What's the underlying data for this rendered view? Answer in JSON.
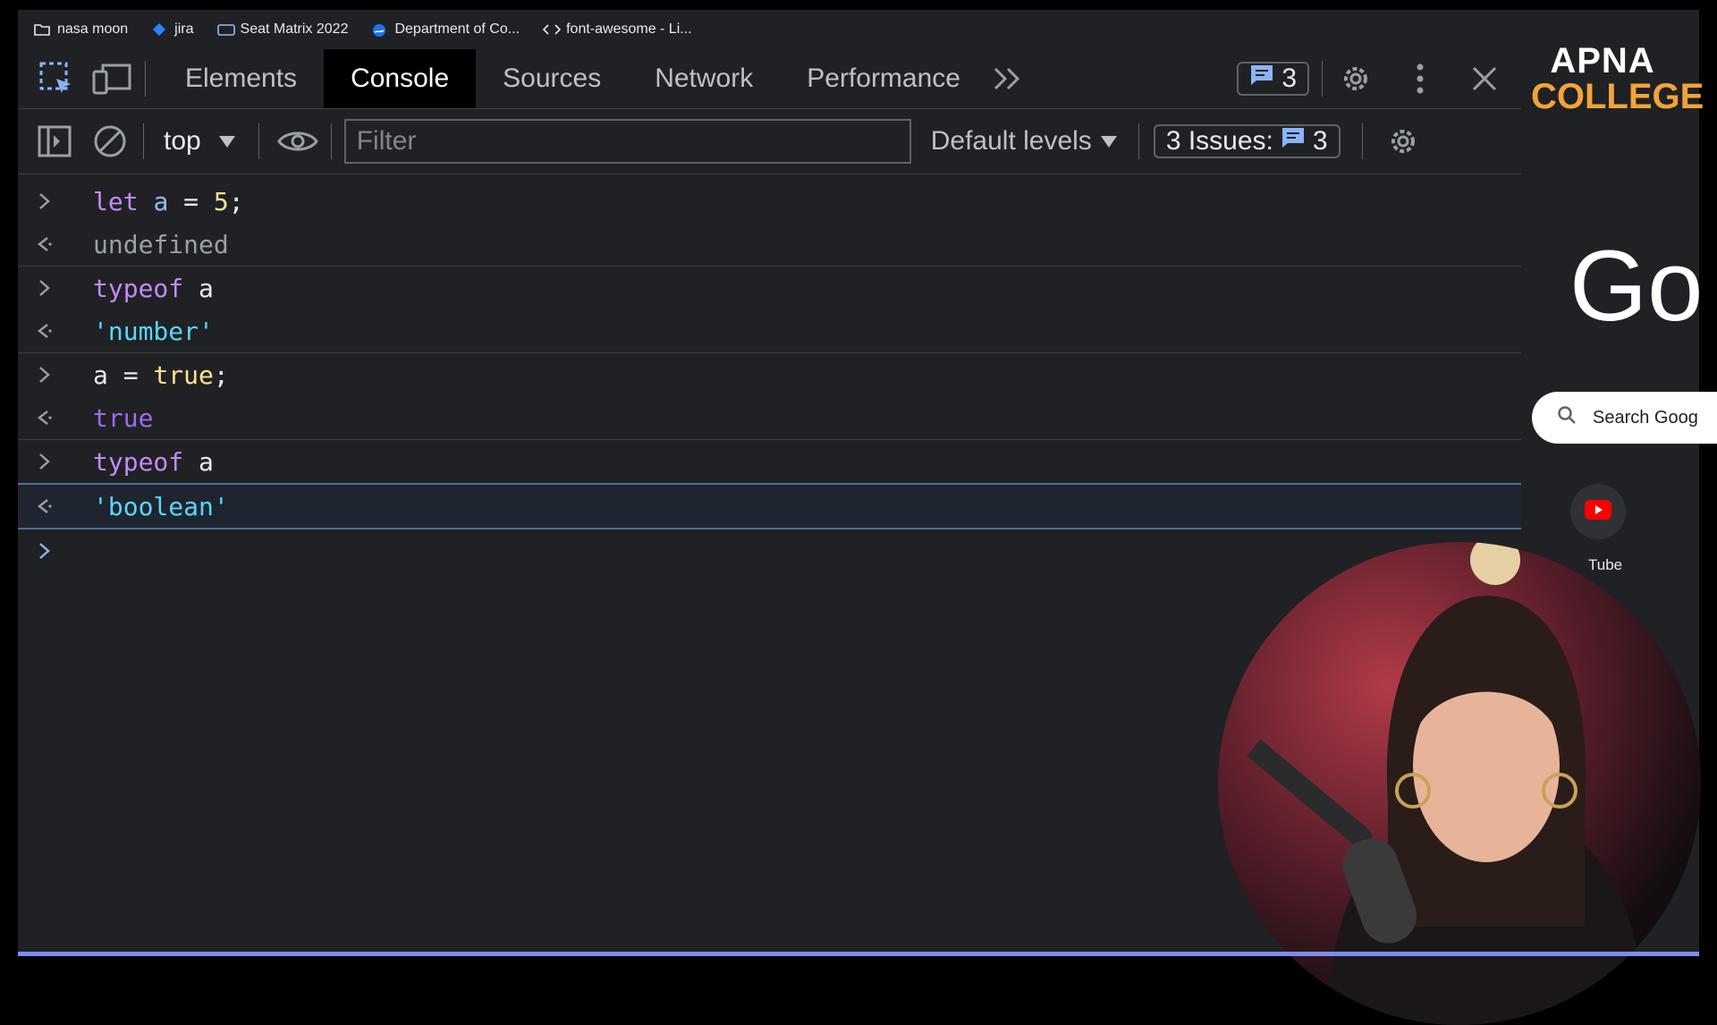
{
  "bookmarks": [
    {
      "label": "nasa moon",
      "icon": "folder-icon"
    },
    {
      "label": "jira",
      "icon": "jira-icon"
    },
    {
      "label": "Seat Matrix 2022",
      "icon": "seat-matrix-icon"
    },
    {
      "label": "Department of Co...",
      "icon": "globe-icon"
    },
    {
      "label": "font-awesome - Li...",
      "icon": "code-icon"
    }
  ],
  "devtools": {
    "tabs": [
      "Elements",
      "Console",
      "Sources",
      "Network",
      "Performance"
    ],
    "active_tab": "Console",
    "messages_count": "3",
    "toolbar": {
      "context": "top",
      "filter_placeholder": "Filter",
      "levels": "Default levels",
      "issues_label": "3 Issues:",
      "issues_count": "3"
    }
  },
  "console": {
    "lines": [
      {
        "dir": "input",
        "parts": [
          [
            "kw",
            "let"
          ],
          [
            "pl",
            " "
          ],
          [
            "var",
            "a"
          ],
          [
            "pl",
            " = "
          ],
          [
            "num",
            "5"
          ],
          [
            "pl",
            ";"
          ]
        ]
      },
      {
        "dir": "output",
        "parts": [
          [
            "und",
            "undefined"
          ]
        ]
      },
      {
        "dir": "input",
        "parts": [
          [
            "kw",
            "typeof"
          ],
          [
            "pl",
            " a"
          ]
        ]
      },
      {
        "dir": "output",
        "parts": [
          [
            "str",
            "'number'"
          ]
        ]
      },
      {
        "dir": "input",
        "parts": [
          [
            "pl",
            "a = "
          ],
          [
            "num",
            "true"
          ],
          [
            "pl",
            ";"
          ]
        ]
      },
      {
        "dir": "output",
        "parts": [
          [
            "bool",
            "true"
          ]
        ]
      },
      {
        "dir": "input",
        "parts": [
          [
            "kw",
            "typeof"
          ],
          [
            "pl",
            " a"
          ]
        ]
      },
      {
        "dir": "output",
        "parts": [
          [
            "str",
            "'boolean'"
          ]
        ]
      }
    ]
  },
  "browser": {
    "logo_line1": "APNA",
    "logo_line2": "COLLEGE",
    "google_partial": "Go",
    "search_placeholder": "Search Goog",
    "shortcut_label": "Tube"
  },
  "colors": {
    "accent": "#7b8cf7",
    "keyword": "#c58af9",
    "string": "#5cd5fb",
    "number": "#fde293"
  }
}
